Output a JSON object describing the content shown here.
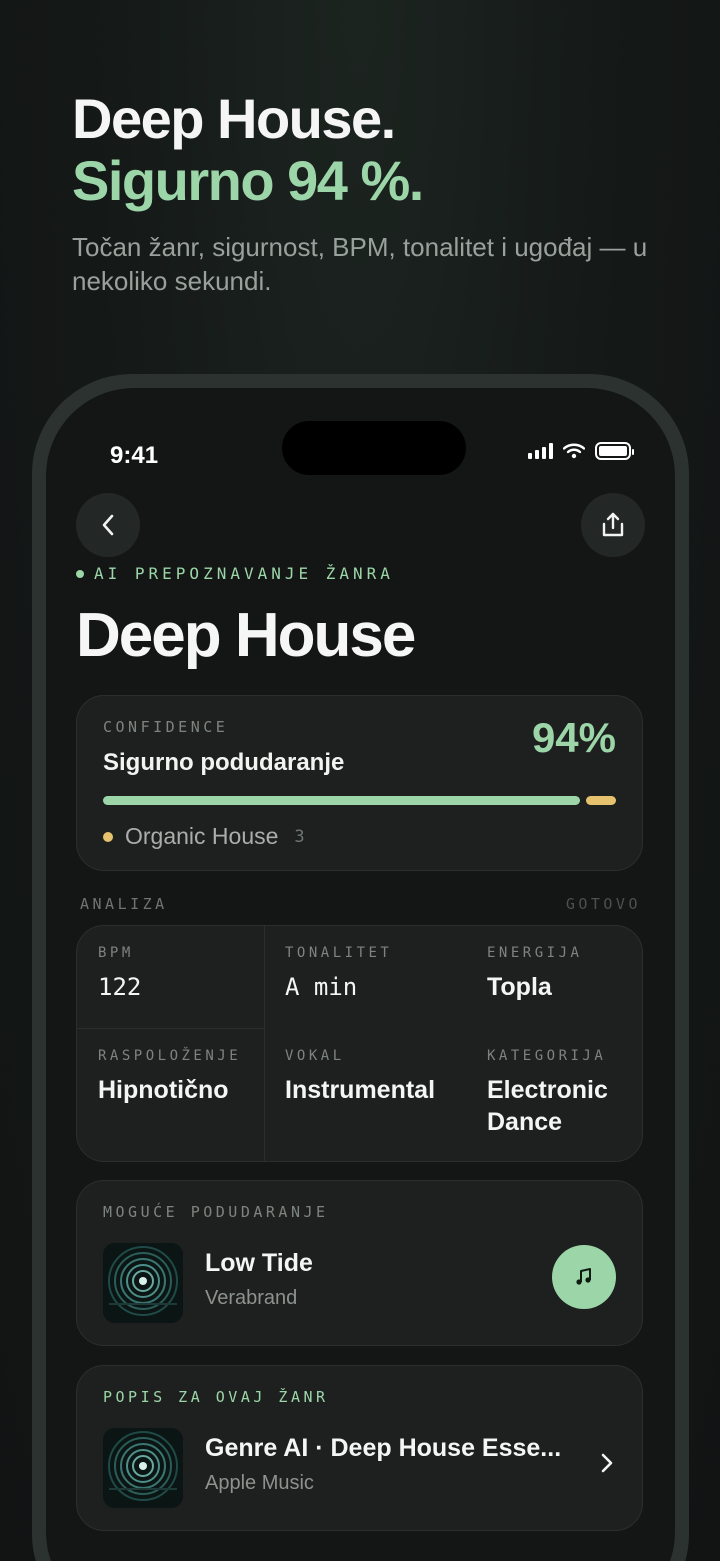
{
  "hero": {
    "title": "Deep House.",
    "accent": "Sigurno 94 %.",
    "subtitle": "Točan žanr, sigurnost, BPM, tonalitet i ugođaj — u nekoliko sekundi."
  },
  "status_bar": {
    "time": "9:41"
  },
  "header": {
    "eyebrow": "AI PREPOZNAVANJE ŽANRA",
    "genre": "Deep House",
    "back_icon": "chevron-left-icon",
    "share_icon": "share-icon"
  },
  "confidence": {
    "label": "CONFIDENCE",
    "match_text": "Sigurno podudaranje",
    "percent_text": "94%",
    "main_fraction": 0.94,
    "alt_name": "Organic House",
    "alt_count": "3"
  },
  "analysis": {
    "label": "ANALIZA",
    "status": "GOTOVO",
    "cells": [
      {
        "label": "BPM",
        "value": "122"
      },
      {
        "label": "TONALITET",
        "value": "A min"
      },
      {
        "label": "ENERGIJA",
        "value": "Topla"
      },
      {
        "label": "RASPOLOŽENJE",
        "value": "Hipnotično"
      },
      {
        "label": "VOKAL",
        "value": "Instrumental"
      },
      {
        "label": "KATEGORIJA",
        "value": "Electronic Dance"
      }
    ]
  },
  "possible_match": {
    "label": "MOGUĆE PODUDARANJE",
    "title": "Low Tide",
    "artist": "Verabrand",
    "action_icon": "music-note-icon"
  },
  "playlist": {
    "label": "POPIS ZA OVAJ ŽANR",
    "title": "Genre AI · Deep House Esse...",
    "source": "Apple Music",
    "action_icon": "chevron-right-icon"
  },
  "colors": {
    "accent_green": "#9cd6a8",
    "accent_yellow": "#e6c26e",
    "background": "#141615",
    "card": "#1d201f"
  }
}
